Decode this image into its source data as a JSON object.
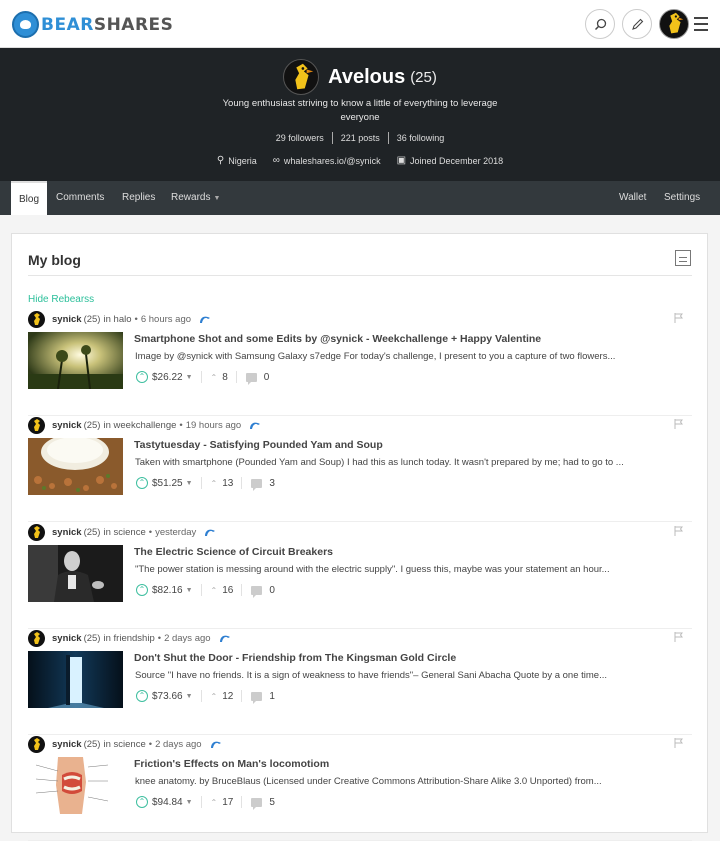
{
  "brand": {
    "logo_a": "BEAR",
    "logo_b": "SHARES"
  },
  "header": {
    "icons": {
      "search": "search-icon",
      "compose": "pencil-icon",
      "menu": "hamburger-menu-icon"
    },
    "accent": "#4a90e2"
  },
  "profile": {
    "name": "Avelous",
    "reputation": "(25)",
    "about": "Young enthusiast striving to know a little of everything to leverage everyone",
    "stats": {
      "followers": "29 followers",
      "posts": "221 posts",
      "following": "36 following"
    },
    "location": "Nigeria",
    "website": "whaleshares.io/@synick",
    "joined": "Joined December 2018"
  },
  "tabs": {
    "blog": "Blog",
    "comments": "Comments",
    "replies": "Replies",
    "rewards": "Rewards",
    "wallet": "Wallet",
    "settings": "Settings"
  },
  "main": {
    "title": "My blog",
    "hide_rebearss": "Hide Rebearss",
    "posts": [
      {
        "author": "synick",
        "rep": "(25)",
        "in": "in",
        "category": "halo",
        "time": "6 hours ago",
        "title": "Smartphone Shot and some Edits by @synick - Weekchallenge + Happy Valentine",
        "body": "Image by @synick with Samsung Galaxy s7edge For today's challenge, I present to you a capture of two flowers...",
        "payout": "$26.22",
        "votes": "8",
        "comments": "0"
      },
      {
        "author": "synick",
        "rep": "(25)",
        "in": "in",
        "category": "weekchallenge",
        "time": "19 hours ago",
        "title": "Tastytuesday - Satisfying Pounded Yam and Soup",
        "body": "Taken with smartphone (Pounded Yam and Soup) I had this as lunch today. It wasn't prepared by me; had to go to ...",
        "payout": "$51.25",
        "votes": "13",
        "comments": "3"
      },
      {
        "author": "synick",
        "rep": "(25)",
        "in": "in",
        "category": "science",
        "time": "yesterday",
        "title": "The Electric Science of Circuit Breakers",
        "body": "\"The power station is messing around with the electric supply\". I guess this, maybe was your statement an hour...",
        "payout": "$82.16",
        "votes": "16",
        "comments": "0"
      },
      {
        "author": "synick",
        "rep": "(25)",
        "in": "in",
        "category": "friendship",
        "time": "2 days ago",
        "title": "Don't Shut the Door - Friendship from The Kingsman Gold Circle",
        "body": "Source \"I have no friends. It is a sign of weakness to have friends\"– General Sani Abacha Quote by a one time...",
        "payout": "$73.66",
        "votes": "12",
        "comments": "1"
      },
      {
        "author": "synick",
        "rep": "(25)",
        "in": "in",
        "category": "science",
        "time": "2 days ago",
        "title": "Friction's Effects on Man's locomotiom",
        "body": "knee anatomy. by BruceBlaus (Licensed under Creative Commons Attribution-Share Alike 3.0 Unported) from...",
        "payout": "$94.84",
        "votes": "17",
        "comments": "5"
      }
    ]
  },
  "colors": {
    "teal": "#2bbf9a",
    "dark_bg": "#1f2326",
    "tab_bg": "#33393d"
  }
}
